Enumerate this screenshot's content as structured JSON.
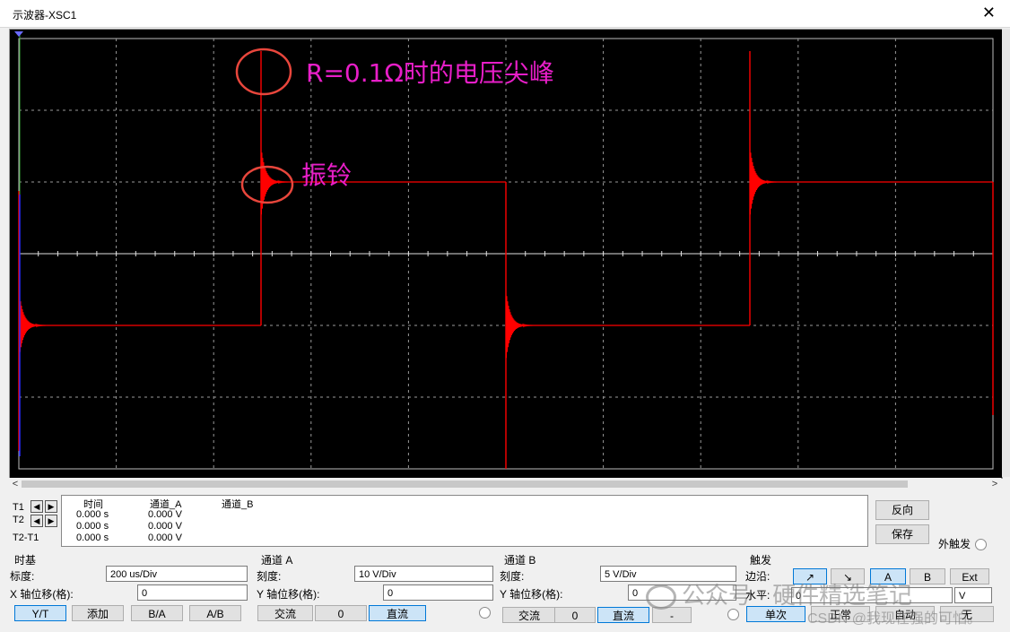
{
  "window": {
    "title": "示波器-XSC1",
    "close_glyph": "✕"
  },
  "annotations": {
    "spike_label": "R=0.1Ω时的电压尖峰",
    "ringing_label": "振铃",
    "label_color": "#e81ec8",
    "circle_color": "#e8463c"
  },
  "trace_color": "#ff0000",
  "readout": {
    "row_labels": [
      "T1",
      "T2",
      "T2-T1"
    ],
    "headers": [
      "时间",
      "通道_A",
      "通道_B"
    ],
    "rows": [
      [
        "0.000 s",
        "0.000 V"
      ],
      [
        "0.000 s",
        "0.000 V"
      ],
      [
        "0.000 s",
        "0.000 V"
      ]
    ],
    "reverse_label": "反向",
    "save_label": "保存",
    "ext_trigger_label": "外触发"
  },
  "timebase": {
    "title": "时基",
    "scale_label": "标度:",
    "scale_value": "200 us/Div",
    "xpos_label": "X 轴位移(格):",
    "xpos_value": "0",
    "buttons": [
      "Y/T",
      "添加",
      "B/A",
      "A/B"
    ]
  },
  "channel_a": {
    "title": "通道 A",
    "scale_label": "刻度:",
    "scale_value": "10  V/Div",
    "ypos_label": "Y 轴位移(格):",
    "ypos_value": "0",
    "buttons": [
      "交流",
      "0",
      "直流"
    ]
  },
  "channel_b": {
    "title": "通道 B",
    "scale_label": "刻度:",
    "scale_value": "5  V/Div",
    "ypos_label": "Y 轴位移(格):",
    "ypos_value": "0",
    "buttons": [
      "交流",
      "0",
      "直流",
      "-"
    ]
  },
  "trigger": {
    "title": "触发",
    "edge_label": "边沿:",
    "edge_buttons": [
      "↗",
      "↘",
      "A",
      "B",
      "Ext"
    ],
    "level_label": "水平:",
    "level_value": "0",
    "level_unit": "V",
    "mode_buttons": [
      "单次",
      "正常",
      "自动",
      "无"
    ]
  },
  "watermarks": {
    "wechat": "公众号 · 硬件精选笔记",
    "csdn": "CSDN @我现在强的可怕。"
  }
}
